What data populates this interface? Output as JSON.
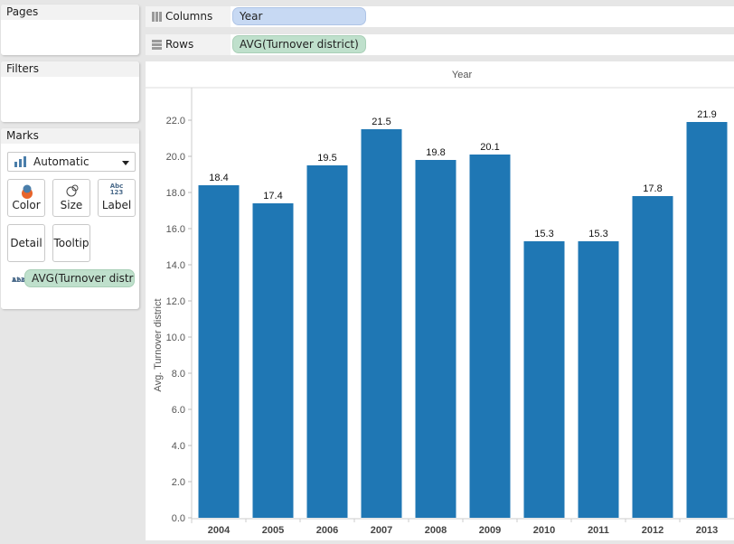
{
  "sidebar": {
    "pages_title": "Pages",
    "filters_title": "Filters",
    "marks": {
      "title": "Marks",
      "mark_type": "Automatic",
      "buttons": {
        "color": "Color",
        "size": "Size",
        "label": "Label",
        "detail": "Detail",
        "tooltip": "Tooltip"
      },
      "label_icon_text_top": "Abc",
      "label_icon_text_bottom": "123",
      "label_pill": "AVG(Turnover distri.."
    }
  },
  "shelves": {
    "columns_label": "Columns",
    "columns_pill": "Year",
    "rows_label": "Rows",
    "rows_pill": "AVG(Turnover district)"
  },
  "colors": {
    "bar": "#1f77b4",
    "columns_pill": "#c7d9f3",
    "rows_pill": "#bfe0cc"
  },
  "chart_data": {
    "type": "bar",
    "title": "Year",
    "xlabel": "",
    "ylabel": "Avg. Turnover district",
    "categories": [
      "2004",
      "2005",
      "2006",
      "2007",
      "2008",
      "2009",
      "2010",
      "2011",
      "2012",
      "2013"
    ],
    "values": [
      18.4,
      17.4,
      19.5,
      21.5,
      19.8,
      20.1,
      15.3,
      15.3,
      17.8,
      21.9
    ],
    "value_labels": [
      "18.4",
      "17.4",
      "19.5",
      "21.5",
      "19.8",
      "20.1",
      "15.3",
      "15.3",
      "17.8",
      "21.9"
    ],
    "yticks": [
      "0.0",
      "2.0",
      "4.0",
      "6.0",
      "8.0",
      "10.0",
      "12.0",
      "14.0",
      "16.0",
      "18.0",
      "20.0",
      "22.0"
    ],
    "ylim": [
      0,
      23.8
    ],
    "grid": false,
    "legend": "none"
  }
}
